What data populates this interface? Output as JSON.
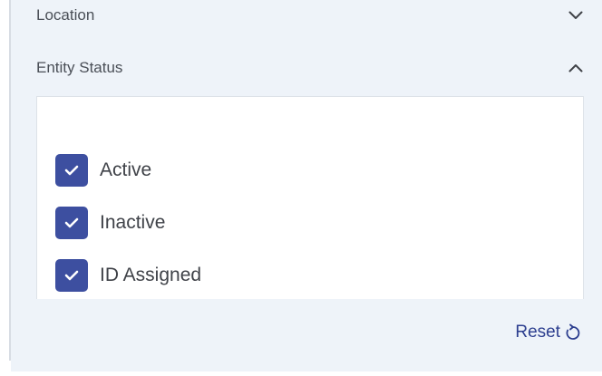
{
  "filters": {
    "location": {
      "label": "Location",
      "expanded": false,
      "chevron_icon": "chevron-down-icon"
    },
    "entity_status": {
      "label": "Entity Status",
      "expanded": true,
      "chevron_icon": "chevron-up-icon",
      "options": [
        {
          "label": "Active",
          "checked": true
        },
        {
          "label": "Inactive",
          "checked": true
        },
        {
          "label": "ID Assigned",
          "checked": true
        }
      ]
    }
  },
  "reset": {
    "label": "Reset",
    "icon": "refresh-icon"
  },
  "colors": {
    "panel_bg": "#eef3f9",
    "checkbox_fill": "#3d4fa0",
    "reset_text": "#2c3e8f",
    "label_text": "#4a4f57"
  }
}
